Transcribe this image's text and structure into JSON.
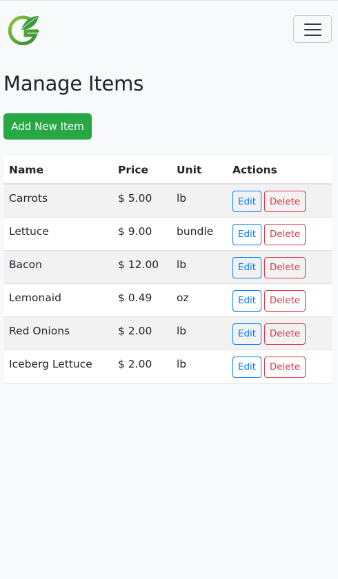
{
  "navbar": {
    "brand_logo": "leaf-g-logo-icon",
    "toggler_icon": "hamburger-menu-icon"
  },
  "page": {
    "title": "Manage Items",
    "add_label": "Add New Item"
  },
  "table": {
    "headers": [
      "Name",
      "Price",
      "Unit",
      "Actions"
    ],
    "rows": [
      {
        "name": "Carrots",
        "price": "$ 5.00",
        "unit": "lb"
      },
      {
        "name": "Lettuce",
        "price": "$ 9.00",
        "unit": "bundle"
      },
      {
        "name": "Bacon",
        "price": "$ 12.00",
        "unit": "lb"
      },
      {
        "name": "Lemonaid",
        "price": "$ 0.49",
        "unit": "oz"
      },
      {
        "name": "Red Onions",
        "price": "$ 2.00",
        "unit": "lb"
      },
      {
        "name": "Iceberg Lettuce",
        "price": "$ 2.00",
        "unit": "lb"
      }
    ],
    "edit_label": "Edit",
    "delete_label": "Delete"
  },
  "colors": {
    "primary": "#007bff",
    "success": "#28a745",
    "danger": "#dc3545",
    "logo_green": "#3c9b3a"
  }
}
